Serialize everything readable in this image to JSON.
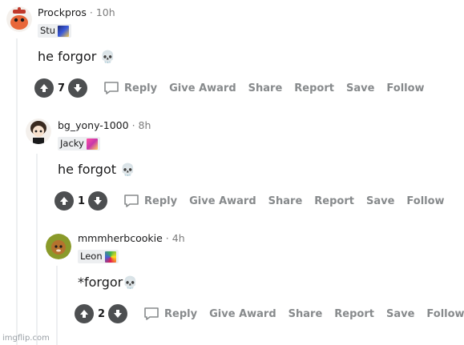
{
  "comments": [
    {
      "username": "Prockpros",
      "time": "10h",
      "flair_text": "Stu",
      "flair_colors": [
        "#1e2a78",
        "#f2c94c"
      ],
      "body": "he forgor",
      "skull": "💀",
      "score": "7",
      "avatar_color": "#f4f0ec",
      "actions": {
        "reply": "Reply",
        "give_award": "Give Award",
        "share": "Share",
        "report": "Report",
        "save": "Save",
        "follow": "Follow"
      }
    },
    {
      "username": "bg_yony-1000",
      "time": "8h",
      "flair_text": "Jacky",
      "flair_colors": [
        "#ff4fa3",
        "#ffd15c"
      ],
      "body": "he forgot",
      "skull": "💀",
      "score": "1",
      "avatar_color": "#f4f0ec",
      "actions": {
        "reply": "Reply",
        "give_award": "Give Award",
        "share": "Share",
        "report": "Report",
        "save": "Save",
        "follow": "Follow"
      }
    },
    {
      "username": "mmmherbcookie",
      "time": "4h",
      "flair_text": "Leon",
      "flair_colors": [
        "#3cb44b",
        "#e6194b"
      ],
      "body": "*forgor",
      "skull": "💀",
      "score": "2",
      "avatar_color": "#8a9a2a",
      "actions": {
        "reply": "Reply",
        "give_award": "Give Award",
        "share": "Share",
        "report": "Report",
        "save": "Save",
        "follow": "Follow"
      }
    }
  ],
  "separator": "·",
  "watermark": "imgflip.com",
  "colors": {
    "action_gray": "#878a8c",
    "vote_circle": "#4d4f51",
    "thread_line": "#edeff1"
  }
}
